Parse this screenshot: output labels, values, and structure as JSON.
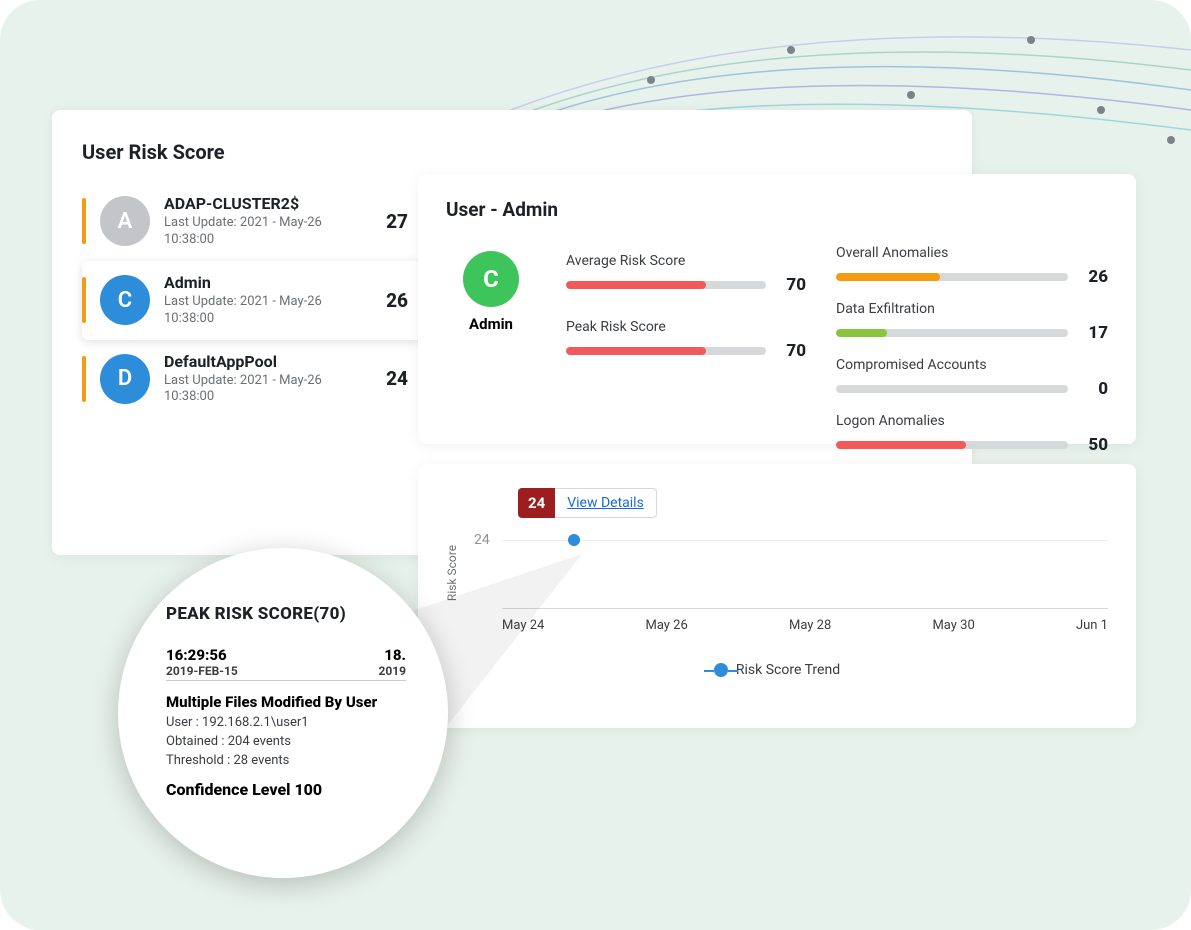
{
  "left": {
    "title": "User Risk Score",
    "users": [
      {
        "initial": "A",
        "avatarClass": "grey",
        "name": "ADAP-CLUSTER2$",
        "sub": "Last Update: 2021 - May-26 10:38:00",
        "score": "27"
      },
      {
        "initial": "C",
        "avatarClass": "blue",
        "name": "Admin",
        "sub": "Last Update: 2021 - May-26 10:38:00",
        "score": "26",
        "selected": true
      },
      {
        "initial": "D",
        "avatarClass": "blue",
        "name": "DefaultAppPool",
        "sub": "Last Update: 2021 - May-26 10:38:00",
        "score": "24"
      }
    ]
  },
  "detail": {
    "title": "User - Admin",
    "avatarInitial": "C",
    "avatarLabel": "Admin",
    "metrics": [
      {
        "label": "Average Risk Score",
        "value": "70",
        "pct": 70,
        "color": "#f05a5a"
      },
      {
        "label": "Peak Risk Score",
        "value": "70",
        "pct": 70,
        "color": "#f05a5a"
      }
    ],
    "anomalies": [
      {
        "label": "Overall Anomalies",
        "value": "26",
        "pct": 45,
        "color": "#f39c12"
      },
      {
        "label": "Data Exfiltration",
        "value": "17",
        "pct": 22,
        "color": "#8bc43f"
      },
      {
        "label": "Compromised Accounts",
        "value": "0",
        "pct": 0,
        "color": "#d6d8da"
      },
      {
        "label": "Logon Anomalies",
        "value": "50",
        "pct": 56,
        "color": "#f05a5a"
      }
    ]
  },
  "chart": {
    "ylabel": "Risk Score",
    "ytick": "24",
    "tooltipValue": "24",
    "tooltipLink": "View Details",
    "xticks": [
      "May 24",
      "May 26",
      "May 28",
      "May 30",
      "Jun 1"
    ],
    "legend": "Risk Score Trend"
  },
  "chart_data": {
    "type": "line",
    "x": [
      "May 24",
      "May 26",
      "May 28",
      "May 30",
      "Jun 1"
    ],
    "series": [
      {
        "name": "Risk Score Trend",
        "values": [
          24,
          null,
          null,
          null,
          null
        ]
      }
    ],
    "title": "",
    "xlabel": "",
    "ylabel": "Risk Score",
    "ylim": [
      0,
      30
    ]
  },
  "zoom": {
    "title": "PEAK RISK SCORE(70)",
    "t1": "16:29:56",
    "d1": "2019-FEB-15",
    "t2": "18.",
    "d2": "2019",
    "eventTitle": "Multiple Files Modified By User",
    "line1": "User : 192.168.2.1\\user1",
    "line2": "Obtained : 204 events",
    "line3": "Threshold : 28 events",
    "confidence": "Confidence Level 100"
  }
}
